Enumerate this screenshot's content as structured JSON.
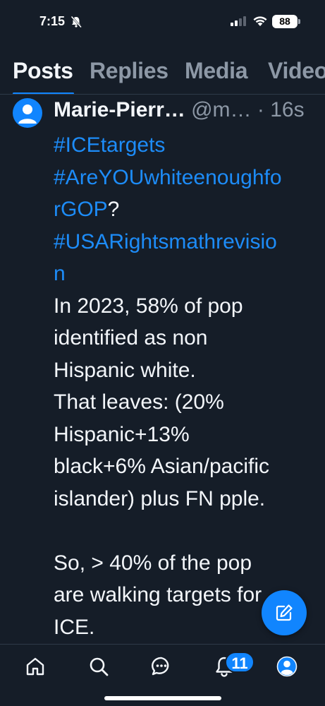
{
  "status_bar": {
    "time": "7:15",
    "battery": "88"
  },
  "tabs": [
    {
      "label": "Posts",
      "active": true
    },
    {
      "label": "Replies",
      "active": false
    },
    {
      "label": "Media",
      "active": false
    },
    {
      "label": "Videos",
      "active": false
    }
  ],
  "post": {
    "author_name": "Marie-Pierr…",
    "author_handle": "@m…",
    "timestamp": "· 16s",
    "lines": [
      {
        "text": "#ICEtargets",
        "hashtag": true
      },
      {
        "text": "#AreYOUwhiteenoughfo",
        "hashtag": true
      },
      {
        "text": "rGOP",
        "hashtag": true,
        "suffix": "?"
      },
      {
        "text": "#USARightsmathrevisio",
        "hashtag": true
      },
      {
        "text": "n",
        "hashtag": true
      },
      {
        "text": "In 2023, 58% of pop"
      },
      {
        "text": "identified as non"
      },
      {
        "text": "Hispanic white."
      },
      {
        "text": "That leaves: (20%"
      },
      {
        "text": "Hispanic+13%"
      },
      {
        "text": "black+6% Asian/pacific"
      },
      {
        "text": "islander) plus FN pple."
      },
      {
        "text": "So, > 40% of the pop"
      },
      {
        "text": "are walking targets for"
      },
      {
        "text": "ICE."
      }
    ]
  },
  "bottom_nav": {
    "items": [
      "home-icon",
      "search-icon",
      "chat-icon",
      "bell-icon",
      "profile-icon"
    ],
    "notification_count": "11"
  },
  "colors": {
    "background": "#151d28",
    "accent": "#1185fe",
    "hashtag": "#1d8cf8",
    "muted": "#8d98a6"
  }
}
